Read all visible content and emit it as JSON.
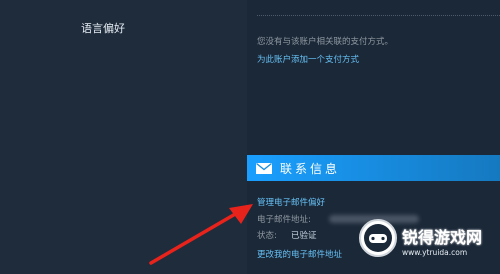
{
  "sidebar": {
    "items": [
      {
        "label": "语言偏好"
      }
    ]
  },
  "payment": {
    "no_method_text": "您没有与该账户相关联的支付方式。",
    "add_method_link": "为此账户添加一个支付方式"
  },
  "contact": {
    "title": "联系信息",
    "icon": "mail-icon",
    "manage_link": "管理电子邮件偏好",
    "email_label": "电子邮件地址:",
    "email_value": "",
    "status_label": "状态:",
    "status_value": "已验证",
    "change_link": "更改我的电子邮件地址"
  },
  "watermark": {
    "title": "锐得游戏网",
    "url": "www.ytruida.com"
  },
  "colors": {
    "page_bg": "#1b2838",
    "sidebar_bg": "#1f2c3c",
    "accent": "#1a9fff",
    "link": "#66c0f4",
    "muted_text": "#8f98a0",
    "arrow": "#e8231c"
  }
}
